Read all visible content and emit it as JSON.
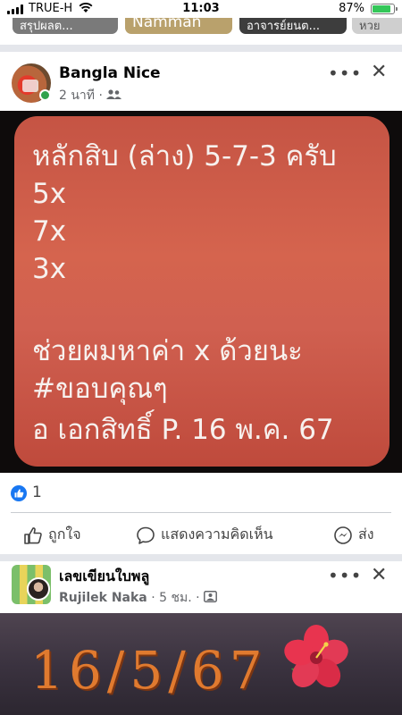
{
  "status_bar": {
    "carrier": "TRUE-H",
    "time": "11:03",
    "battery": "87%",
    "battery_level": 0.87,
    "accent": "#34c759"
  },
  "stories": [
    {
      "label": "สรุปผลต..."
    },
    {
      "label": "Namman"
    },
    {
      "label": "อาจารย์ยนต..."
    },
    {
      "label": "หวย"
    }
  ],
  "post1": {
    "author": "Bangla Nice",
    "time": "2 นาที",
    "audience_icon": "friends-icon",
    "image_lines": [
      "หลักสิบ (ล่าง) 5-7-3 ครับ",
      "5x",
      "7x",
      "3x",
      "ช่วยผมหาค่า x ด้วยนะ",
      "#ขอบคุณๆ",
      "อ เอกสิทธิ์ P. 16 พ.ค. 67"
    ],
    "like_count": "1",
    "actions": {
      "like": "ถูกใจ",
      "comment": "แสดงความคิดเห็น",
      "share": "ส่ง"
    }
  },
  "post2": {
    "group": "เลขเขียนใบพลู",
    "author": "Rujilek Naka",
    "time": "5 ชม.",
    "audience_icon": "photo-icon",
    "image_text": "16/5/67"
  },
  "colors": {
    "facebook_blue": "#1877f2",
    "card_red": "#cf5d4b",
    "online_green": "#31a24c"
  }
}
